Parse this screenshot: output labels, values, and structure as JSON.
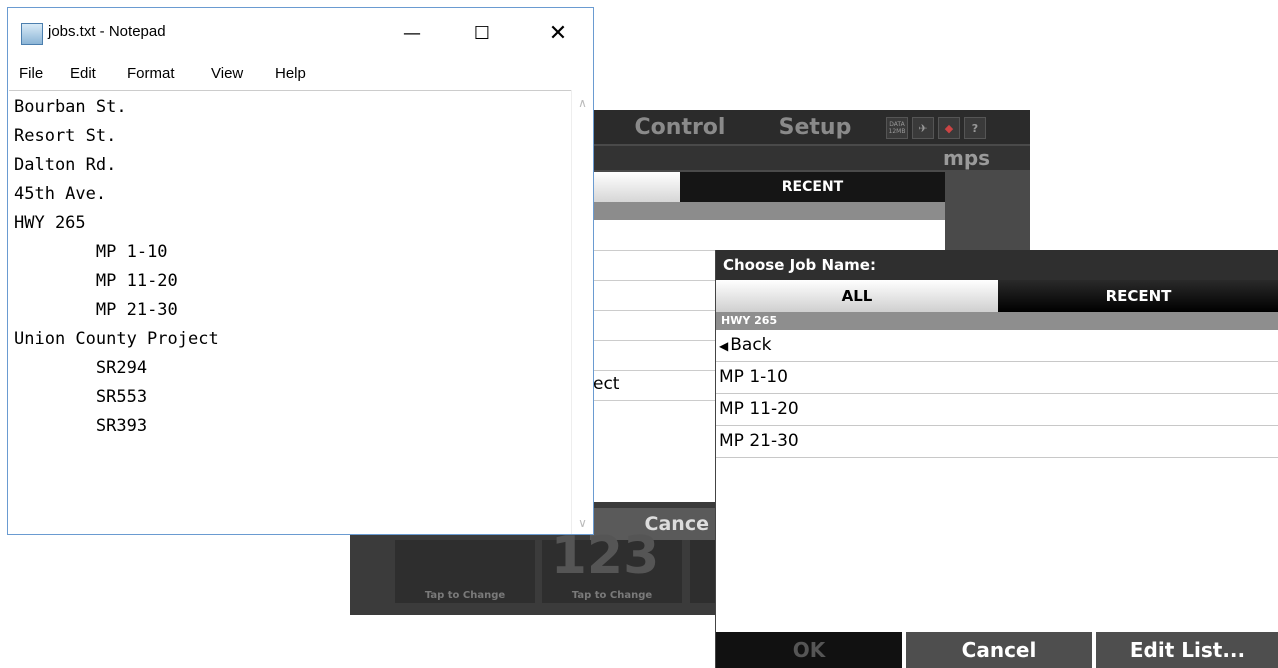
{
  "background_app": {
    "tabs": [
      "Control",
      "Setup"
    ],
    "icons": [
      "data-12mb-icon",
      "satellite-icon",
      "signal-icon",
      "help-icon"
    ],
    "data_icon_text": "DATA 12MB",
    "help_text": "?",
    "row2_text": "mps",
    "recent_tab": "RECENT",
    "partial_row_text": "ect",
    "cancel_label": "Cance",
    "tile_number": "123",
    "tile_labels": [
      "Tap to Change",
      "Tap to Change"
    ]
  },
  "notepad": {
    "title": "jobs.txt - Notepad",
    "controls": {
      "minimize": "—",
      "maximize": "☐",
      "close": "✕"
    },
    "menu": [
      "File",
      "Edit",
      "Format",
      "View",
      "Help"
    ],
    "lines": [
      "Bourban St.",
      "Resort St.",
      "Dalton Rd.",
      "45th Ave.",
      "HWY 265",
      "\tMP 1-10",
      "\tMP 11-20",
      "\tMP 21-30",
      "Union County Project",
      "\tSR294",
      "\tSR553",
      "\tSR393"
    ]
  },
  "dialog": {
    "title": "Choose Job Name:",
    "tabs": {
      "all": "ALL",
      "recent": "RECENT"
    },
    "path": "HWY 265",
    "back_label": "Back",
    "items": [
      "MP 1-10",
      "MP 11-20",
      "MP 21-30"
    ],
    "buttons": {
      "ok": "OK",
      "cancel": "Cancel",
      "edit": "Edit List..."
    }
  }
}
